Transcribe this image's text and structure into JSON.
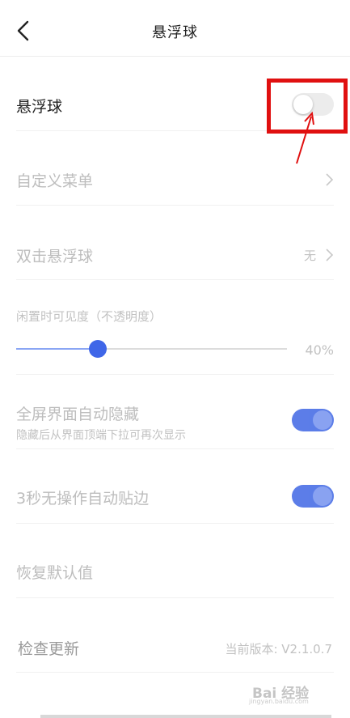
{
  "header": {
    "title": "悬浮球"
  },
  "rows": {
    "floating_ball": {
      "label": "悬浮球",
      "toggle": "off"
    },
    "custom_menu": {
      "label": "自定义菜单"
    },
    "double_click": {
      "label": "双击悬浮球",
      "value": "无"
    },
    "opacity": {
      "label": "闲置时可见度（不透明度）",
      "value": "40%",
      "level": 0.3
    },
    "fullscreen_hide": {
      "label": "全屏界面自动隐藏",
      "sub": "隐藏后从界面顶端下拉可再次显示",
      "toggle": "on"
    },
    "auto_edge": {
      "label": "3秒无操作自动贴边",
      "toggle": "on"
    },
    "restore_default": {
      "label": "恢复默认值"
    },
    "check_update": {
      "label": "检查更新",
      "value": "当前版本: V2.1.0.7"
    }
  },
  "watermark": {
    "text": "Bai 经验",
    "sub": "jingyan.baidu.com"
  },
  "colors": {
    "accent": "#3f66e8",
    "highlight": "#e01010"
  }
}
